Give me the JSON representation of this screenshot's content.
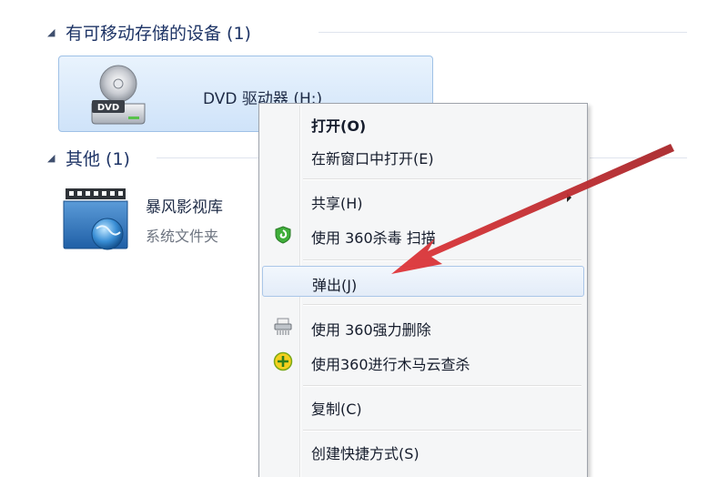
{
  "groups": {
    "removable": {
      "title": "有可移动存储的设备 (1)"
    },
    "other": {
      "title": "其他 (1)"
    }
  },
  "drive": {
    "label": "DVD 驱动器 (H:)",
    "icon": "dvd-drive-icon",
    "badge": "DVD"
  },
  "library": {
    "name": "暴风影视库",
    "type": "系统文件夹",
    "icon": "video-library-icon"
  },
  "context_menu": {
    "items": [
      {
        "label": "打开(O)",
        "bold": true
      },
      {
        "label": "在新窗口中打开(E)"
      },
      {
        "label": "共享(H)",
        "submenu": true
      },
      {
        "label": "使用 360杀毒 扫描",
        "icon": "360-antivirus-shield-icon"
      },
      {
        "label": "弹出(J)",
        "highlighted": true
      },
      {
        "label": "使用 360强力删除",
        "icon": "shredder-icon"
      },
      {
        "label": "使用360进行木马云查杀",
        "icon": "360-trojan-scan-icon"
      },
      {
        "label": "复制(C)"
      },
      {
        "label": "创建快捷方式(S)"
      }
    ]
  },
  "colors": {
    "selection_fill": "#cfe3f9",
    "selection_border": "#9fc1e6",
    "menu_background": "#f5f6f7",
    "arrow": "#c9272b"
  }
}
